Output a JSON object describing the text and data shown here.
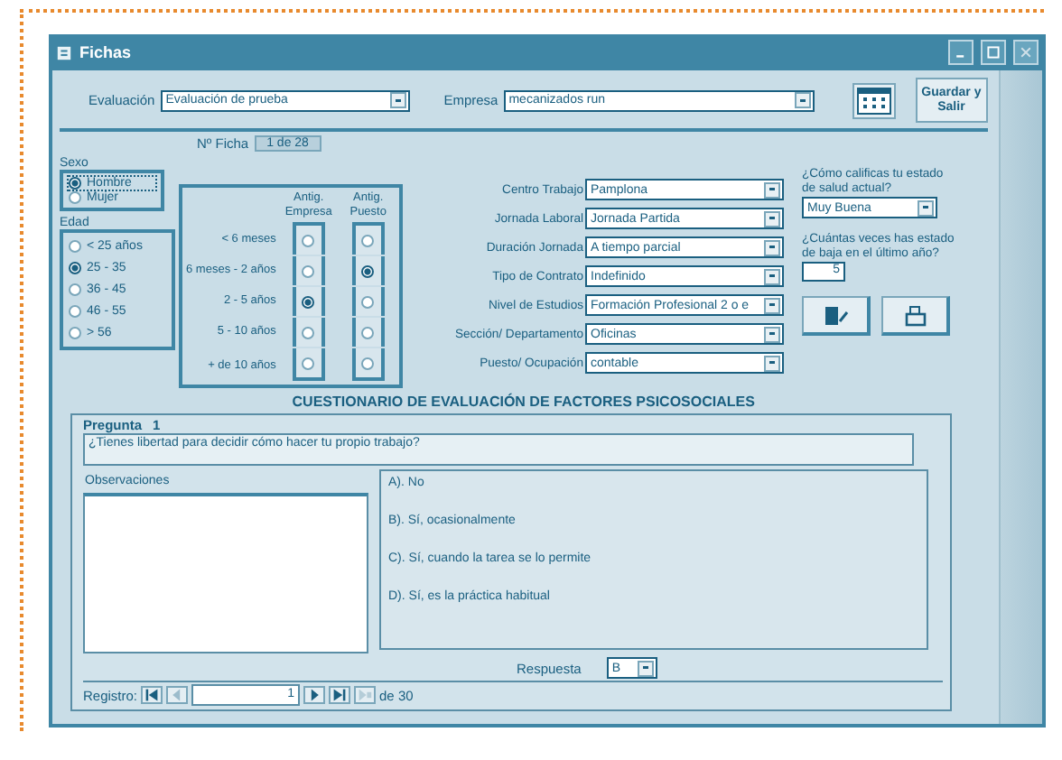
{
  "window": {
    "title": "Fichas"
  },
  "header": {
    "evaluacion": {
      "label": "Evaluación",
      "value": "Evaluación de prueba"
    },
    "empresa": {
      "label": "Empresa",
      "value": "mecanizados run"
    },
    "save_button": "Guardar y Salir"
  },
  "ficha": {
    "label": "Nº Ficha",
    "value": "1 de 28"
  },
  "sexo": {
    "title": "Sexo",
    "options": [
      {
        "label": "Hombre",
        "selected": true
      },
      {
        "label": "Mujer",
        "selected": false
      }
    ]
  },
  "edad": {
    "title": "Edad",
    "options": [
      {
        "label": "< 25 años",
        "selected": false
      },
      {
        "label": "25 - 35",
        "selected": true
      },
      {
        "label": "36 - 45",
        "selected": false
      },
      {
        "label": "46 - 55",
        "selected": false
      },
      {
        "label": "> 56",
        "selected": false
      }
    ]
  },
  "antiguedad": {
    "columns": [
      "Antig. Empresa",
      "Antig. Puesto"
    ],
    "rows": [
      {
        "label": "< 6 meses",
        "options": [
          {
            "selected": false
          },
          {
            "selected": false
          }
        ]
      },
      {
        "label": "6 meses - 2 años",
        "options": [
          {
            "selected": false
          },
          {
            "selected": true
          }
        ]
      },
      {
        "label": "2 - 5 años",
        "options": [
          {
            "selected": true
          },
          {
            "selected": false
          }
        ]
      },
      {
        "label": "5 - 10 años",
        "options": [
          {
            "selected": false
          },
          {
            "selected": false
          }
        ]
      },
      {
        "label": "+ de 10 años",
        "options": [
          {
            "selected": false
          },
          {
            "selected": false
          }
        ]
      }
    ]
  },
  "fields": [
    {
      "label": "Centro Trabajo",
      "value": "Pamplona"
    },
    {
      "label": "Jornada Laboral",
      "value": "Jornada Partida"
    },
    {
      "label": "Duración Jornada",
      "value": "A tiempo parcial"
    },
    {
      "label": "Tipo de Contrato",
      "value": "Indefinido"
    },
    {
      "label": "Nivel de Estudios",
      "value": "Formación Profesional 2 o e"
    },
    {
      "label": "Sección/ Departamento",
      "value": "Oficinas"
    },
    {
      "label": "Puesto/ Ocupación",
      "value": "contable"
    }
  ],
  "salud": {
    "question": "¿Cómo calificas tu estado de salud actual?",
    "value": "Muy Buena"
  },
  "baja": {
    "question": "¿Cuántas veces has estado de baja en el último año?",
    "value": "5"
  },
  "section_title": "CUESTIONARIO DE EVALUACIÓN DE FACTORES PSICOSOCIALES",
  "pregunta": {
    "label": "Pregunta",
    "number": "1",
    "text": "¿Tienes libertad para decidir cómo hacer tu propio trabajo?"
  },
  "observaciones": {
    "label": "Observaciones"
  },
  "answers": [
    "A). No",
    "B). Sí, ocasionalmente",
    "C). Sí, cuando la tarea se lo permite",
    "D). Sí, es la práctica habitual"
  ],
  "respuesta": {
    "label": "Respuesta",
    "value": "B"
  },
  "navigation": {
    "label": "Registro:",
    "value": "1",
    "total": "de 30"
  }
}
